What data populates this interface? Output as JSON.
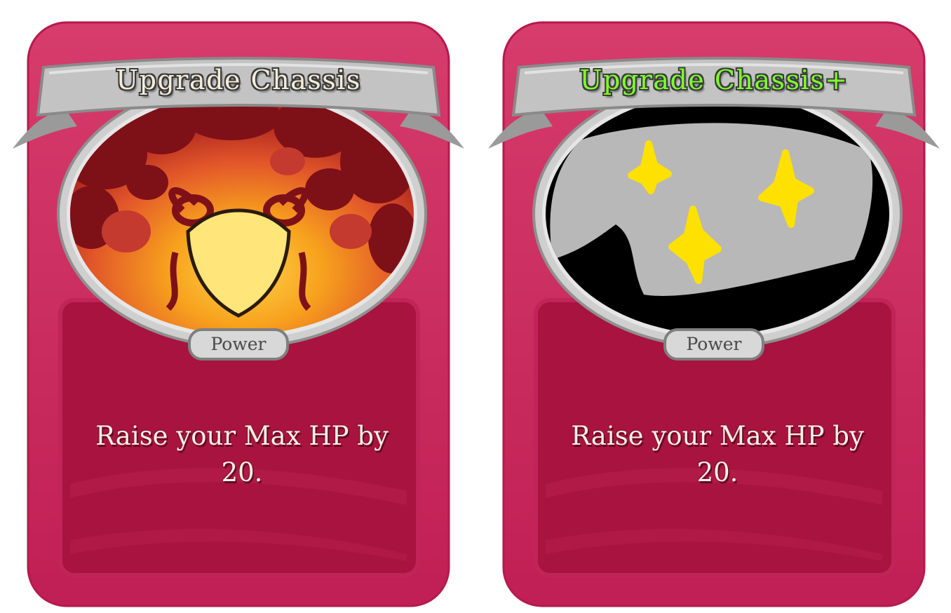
{
  "cards": [
    {
      "title": "Upgrade Chassis",
      "type": "Power",
      "description": "Raise your Max HP by 20.",
      "upgraded": false,
      "art": "shield-flames-icon",
      "title_color": "#f4ecd8"
    },
    {
      "title": "Upgrade Chassis+",
      "type": "Power",
      "description": "Raise your Max HP by 20.",
      "upgraded": true,
      "art": "sparkle-placeholder-icon",
      "title_color": "#7dff2e"
    }
  ],
  "colors": {
    "card_body": "#c8235a",
    "description_panel": "#a8133f",
    "frame_silver": "#b9b9b9"
  }
}
